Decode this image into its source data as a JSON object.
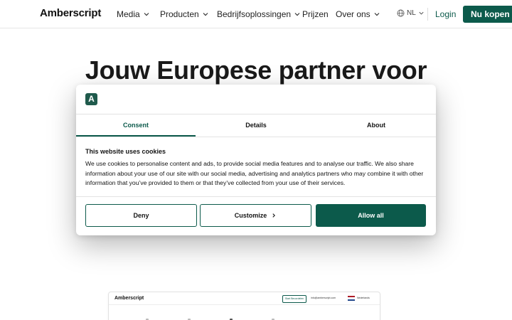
{
  "nav": {
    "logo": "Amberscript",
    "items": [
      {
        "label": "Media",
        "dropdown": true
      },
      {
        "label": "Producten",
        "dropdown": true
      },
      {
        "label": "Bedrijfsoplossingen",
        "dropdown": true
      },
      {
        "label": "Prijzen",
        "dropdown": false
      },
      {
        "label": "Over ons",
        "dropdown": true
      }
    ],
    "language": "NL",
    "login": "Login",
    "buy": "Nu kopen"
  },
  "hero": {
    "title": "Jouw Europese partner voor"
  },
  "cookie_dialog": {
    "logo_letter": "A",
    "tabs": [
      {
        "label": "Consent",
        "active": true
      },
      {
        "label": "Details",
        "active": false
      },
      {
        "label": "About",
        "active": false
      }
    ],
    "heading": "This website uses cookies",
    "body": "We use cookies to personalise content and ads, to provide social media features and to analyse our traffic. We also share information about your use of our site with our social media, advertising and analytics partners who may combine it with other information that you’ve provided to them or that they’ve collected from your use of their services.",
    "buttons": {
      "deny": "Deny",
      "customize": "Customize",
      "allow": "Allow all"
    }
  },
  "preview": {
    "logo": "Amberscript",
    "button": "Start Beoordelen",
    "email": "info@amberscript.com",
    "language": "Nederlands"
  },
  "colors": {
    "brand": "#0c5a4b",
    "logo_bg": "#1f5a4c"
  }
}
